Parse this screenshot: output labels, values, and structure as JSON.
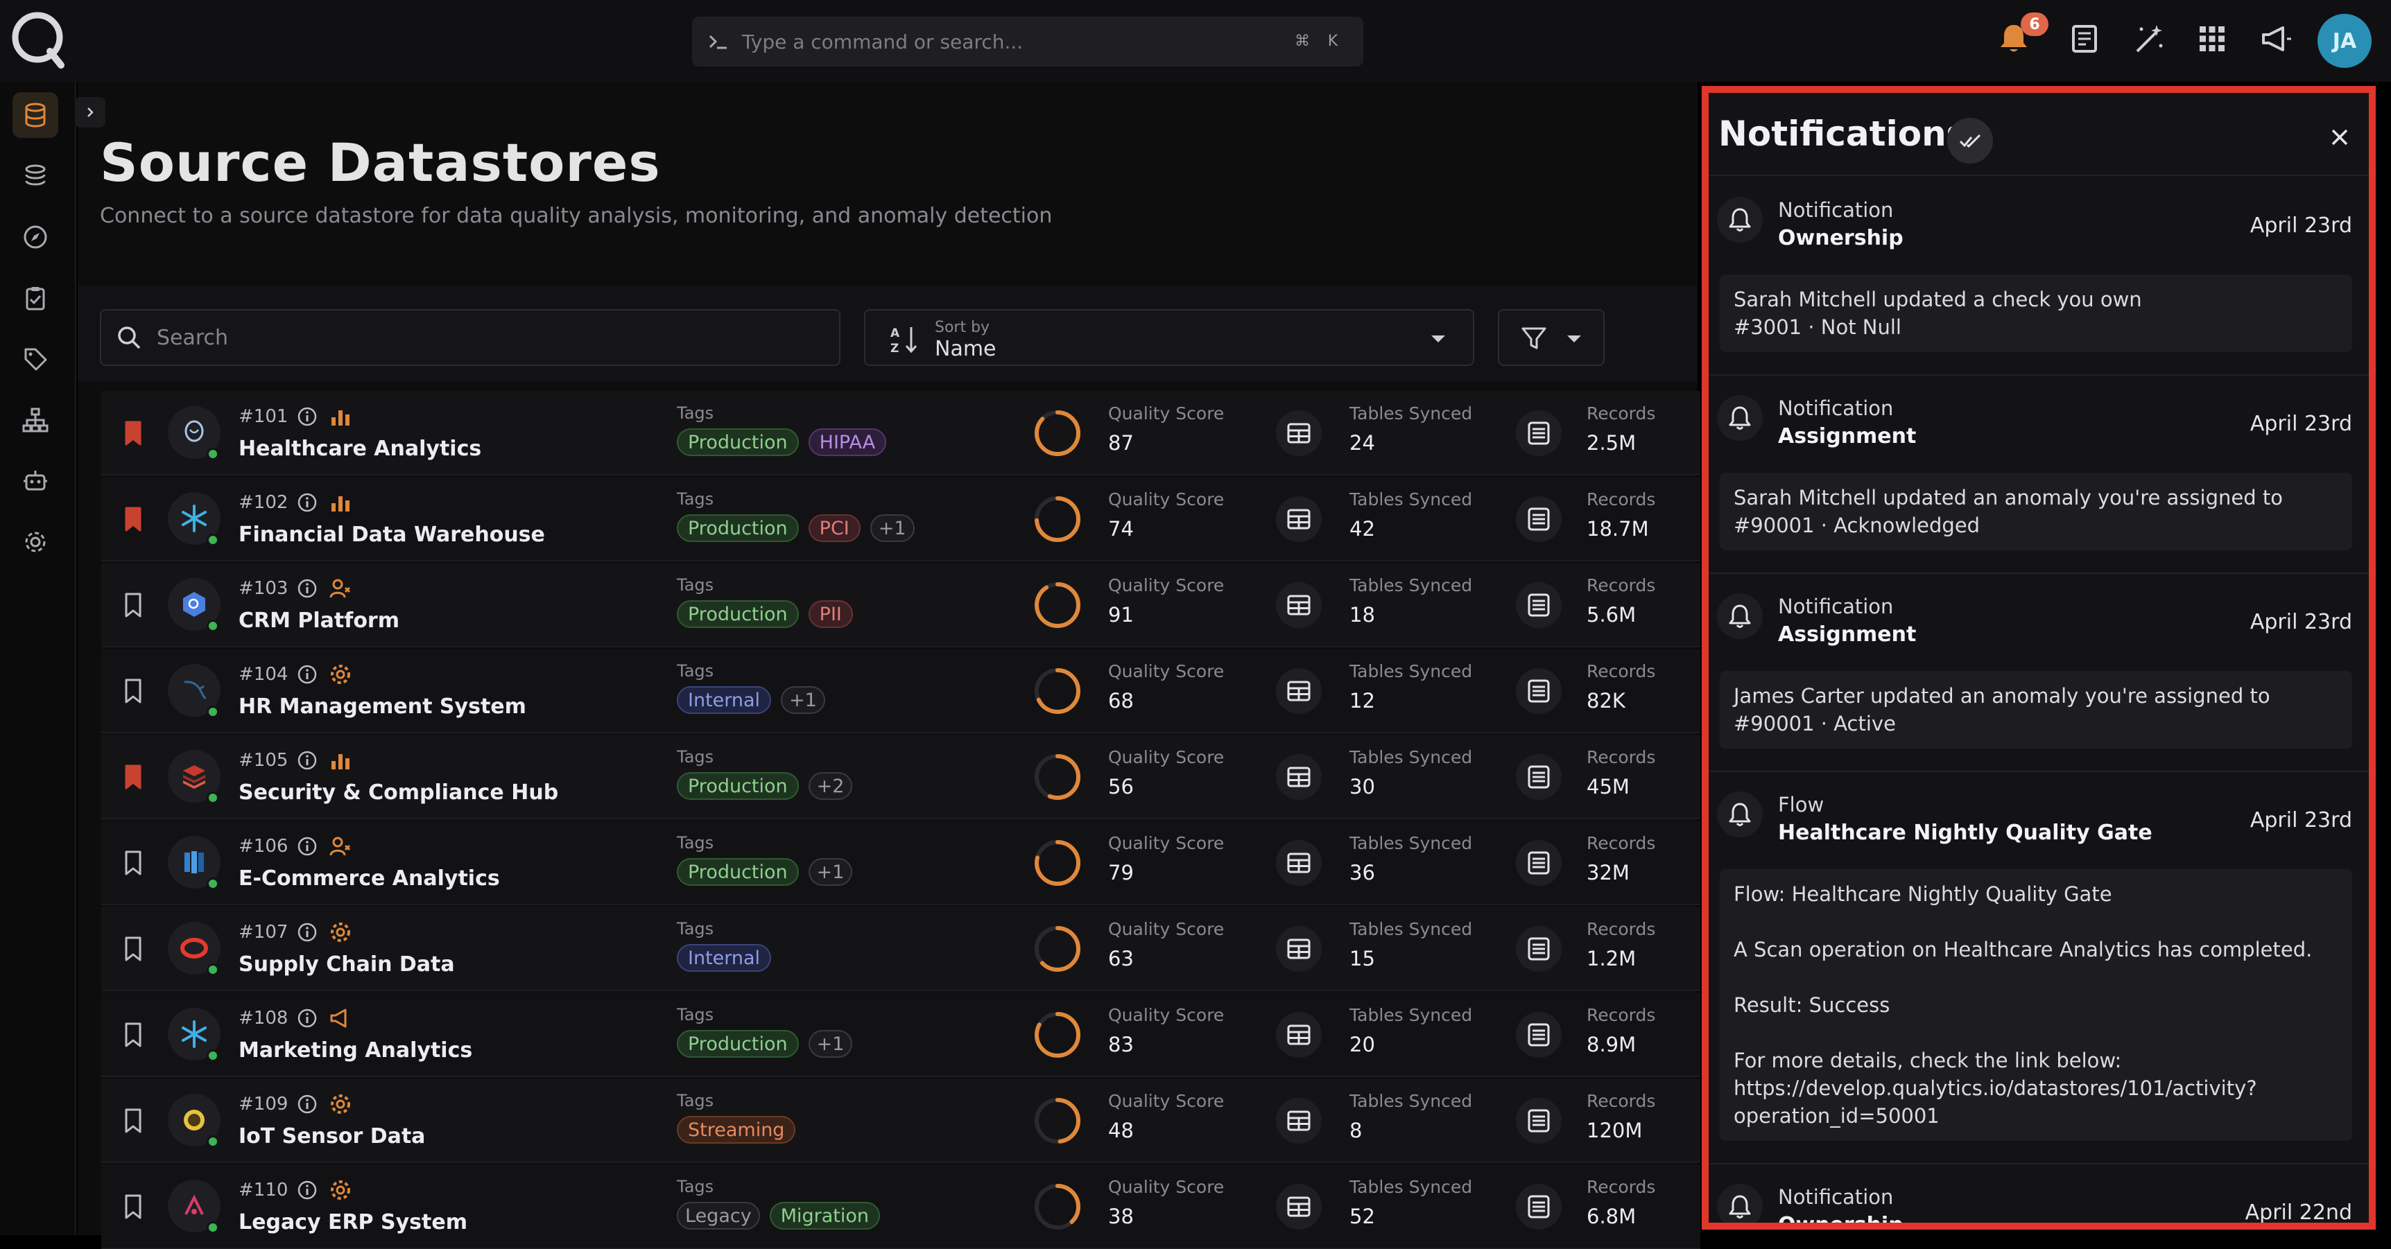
{
  "topbar": {
    "command_placeholder": "Type a command or search...",
    "shortcut_keys": [
      "⌘",
      "K"
    ],
    "notification_count": "6",
    "avatar_initials": "JA",
    "accent_color": "#e0883a"
  },
  "sidebar": {
    "items": [
      {
        "name": "datastores-icon",
        "active": true
      },
      {
        "name": "explore-icon"
      },
      {
        "name": "compass-icon"
      },
      {
        "name": "checklist-icon"
      },
      {
        "name": "tag-icon"
      },
      {
        "name": "flows-icon"
      },
      {
        "name": "agent-icon"
      },
      {
        "name": "settings-icon"
      }
    ]
  },
  "page": {
    "title": "Source Datastores",
    "subtitle": "Connect to a source datastore for data quality analysis, monitoring, and anomaly detection",
    "search_placeholder": "Search",
    "sort_label": "Sort by",
    "sort_value": "Name"
  },
  "labels": {
    "tags": "Tags",
    "quality_score": "Quality Score",
    "tables_synced": "Tables Synced",
    "records": "Records"
  },
  "datastores": [
    {
      "id": "#101",
      "name": "Healthcare Analytics",
      "bookmarked": true,
      "kind": "chart",
      "icon": "postgres-icon",
      "tags": [
        {
          "t": "Production",
          "c": "g"
        },
        {
          "t": "HIPAA",
          "c": "p"
        }
      ],
      "quality": "87",
      "tables": "24",
      "records": "2.5M"
    },
    {
      "id": "#102",
      "name": "Financial Data Warehouse",
      "bookmarked": true,
      "kind": "chart",
      "icon": "snowflake-icon",
      "tags": [
        {
          "t": "Production",
          "c": "g"
        },
        {
          "t": "PCI",
          "c": "r"
        },
        {
          "t": "+1",
          "c": "n"
        }
      ],
      "quality": "74",
      "tables": "42",
      "records": "18.7M"
    },
    {
      "id": "#103",
      "name": "CRM Platform",
      "bookmarked": false,
      "kind": "user",
      "icon": "bigquery-icon",
      "tags": [
        {
          "t": "Production",
          "c": "g"
        },
        {
          "t": "PII",
          "c": "r"
        }
      ],
      "quality": "91",
      "tables": "18",
      "records": "5.6M"
    },
    {
      "id": "#104",
      "name": "HR Management System",
      "bookmarked": false,
      "kind": "gear",
      "icon": "mysql-icon",
      "tags": [
        {
          "t": "Internal",
          "c": "b"
        },
        {
          "t": "+1",
          "c": "n"
        }
      ],
      "quality": "68",
      "tables": "12",
      "records": "82K"
    },
    {
      "id": "#105",
      "name": "Security & Compliance Hub",
      "bookmarked": true,
      "kind": "chart",
      "icon": "redshift-icon",
      "tags": [
        {
          "t": "Production",
          "c": "g"
        },
        {
          "t": "+2",
          "c": "n"
        }
      ],
      "quality": "56",
      "tables": "30",
      "records": "45M"
    },
    {
      "id": "#106",
      "name": "E-Commerce Analytics",
      "bookmarked": false,
      "kind": "user",
      "icon": "synapse-icon",
      "tags": [
        {
          "t": "Production",
          "c": "g"
        },
        {
          "t": "+1",
          "c": "n"
        }
      ],
      "quality": "79",
      "tables": "36",
      "records": "32M"
    },
    {
      "id": "#107",
      "name": "Supply Chain Data",
      "bookmarked": false,
      "kind": "gear",
      "icon": "oracle-icon",
      "tags": [
        {
          "t": "Internal",
          "c": "b"
        }
      ],
      "quality": "63",
      "tables": "15",
      "records": "1.2M"
    },
    {
      "id": "#108",
      "name": "Marketing Analytics",
      "bookmarked": false,
      "kind": "megaphone",
      "icon": "snowflake-icon",
      "tags": [
        {
          "t": "Production",
          "c": "g"
        },
        {
          "t": "+1",
          "c": "n"
        }
      ],
      "quality": "83",
      "tables": "20",
      "records": "8.9M"
    },
    {
      "id": "#109",
      "name": "IoT Sensor Data",
      "bookmarked": false,
      "kind": "gear",
      "icon": "hive-icon",
      "tags": [
        {
          "t": "Streaming",
          "c": "o"
        }
      ],
      "quality": "48",
      "tables": "8",
      "records": "120M"
    },
    {
      "id": "#110",
      "name": "Legacy ERP System",
      "bookmarked": false,
      "kind": "gear",
      "icon": "db2-icon",
      "tags": [
        {
          "t": "Legacy",
          "c": "n"
        },
        {
          "t": "Migration",
          "c": "g"
        }
      ],
      "quality": "38",
      "tables": "52",
      "records": "6.8M"
    }
  ],
  "notifications": {
    "title": "Notifications",
    "items": [
      {
        "type": "Notification",
        "title": "Ownership",
        "date": "April 23rd",
        "body": [
          "Sarah Mitchell updated a check you own",
          "#3001 · Not Null"
        ]
      },
      {
        "type": "Notification",
        "title": "Assignment",
        "date": "April 23rd",
        "body": [
          "Sarah Mitchell updated an anomaly you're assigned to",
          "#90001 · Acknowledged"
        ]
      },
      {
        "type": "Notification",
        "title": "Assignment",
        "date": "April 23rd",
        "body": [
          "James Carter updated an anomaly you're assigned to",
          "#90001 · Active"
        ]
      },
      {
        "type": "Flow",
        "title": "Healthcare Nightly Quality Gate",
        "date": "April 23rd",
        "body": [
          "Flow: Healthcare Nightly Quality Gate",
          "",
          "A Scan operation on Healthcare Analytics has completed.",
          "",
          "Result: Success",
          "",
          "For more details, check the link below:",
          "https://develop.qualytics.io/datastores/101/activity?",
          "operation_id=50001"
        ]
      },
      {
        "type": "Notification",
        "title": "Ownership",
        "date": "April 22nd",
        "body": []
      }
    ]
  }
}
